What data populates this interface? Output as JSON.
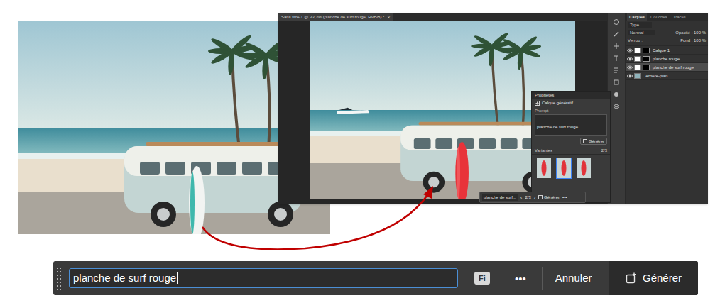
{
  "photoshop": {
    "document_tab": {
      "title": "Sans titre-1 @ 33,3% (planche de surf rouge, RVB/8) *",
      "close": "×"
    },
    "layers_panel": {
      "tabs": [
        {
          "label": "Calques",
          "selected": true
        },
        {
          "label": "Couches",
          "selected": false
        },
        {
          "label": "Tracés",
          "selected": false
        }
      ],
      "filter": "Type",
      "blend_mode": "Normal",
      "opacity": "Opacité : 100 %",
      "lock": "Verrou :",
      "fill": "Fond : 100 %",
      "layers": [
        {
          "name": "Calque 1",
          "visible": true,
          "selected": false,
          "mask": true
        },
        {
          "name": "planche rouge",
          "visible": true,
          "selected": false,
          "mask": true
        },
        {
          "name": "planche de surf rouge",
          "visible": true,
          "selected": true,
          "mask": true
        },
        {
          "name": "Arrière-plan",
          "visible": true,
          "selected": false,
          "mask": false
        }
      ]
    },
    "properties_panel": {
      "title": "Propriétés",
      "layer_type": "Calque génératif",
      "prompt_label": "Prompt",
      "prompt": "planche de surf rouge",
      "generate": "Générer",
      "variations_label": "Variantes",
      "variations_count": "2/3",
      "variations": [
        {
          "selected": false
        },
        {
          "selected": true
        },
        {
          "selected": false
        }
      ]
    },
    "contextual_bar": {
      "prompt": "planche de surf...",
      "previous": "‹",
      "counter": "2/3",
      "next": "›",
      "generate": "Générer",
      "more": "•••"
    }
  },
  "task_bar": {
    "prompt": "planche de surf rouge",
    "badge": "Fi",
    "more": "•••",
    "cancel": "Annuler",
    "generate": "Générer"
  }
}
